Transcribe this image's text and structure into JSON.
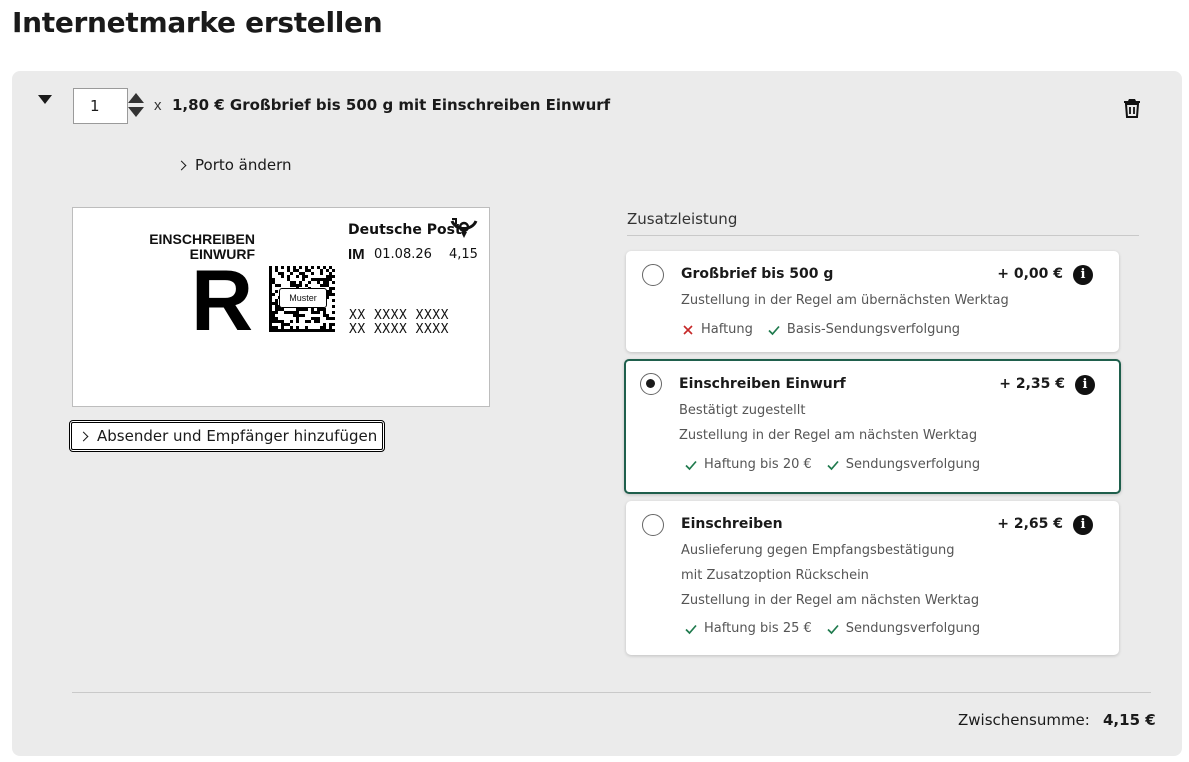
{
  "page": {
    "title": "Internetmarke erstellen"
  },
  "product": {
    "quantity": "1",
    "multiplier": "x",
    "title": "1,80 € Großbrief bis 500 g mit Einschreiben Einwurf",
    "porto_change_label": "Porto ändern"
  },
  "stamp": {
    "label_line_1": "EINSCHREIBEN",
    "label_line_2": "EINWURF",
    "big_letter": "R",
    "muster": "Muster",
    "brand": "Deutsche Post",
    "im": "IM",
    "date": "01.08.26",
    "value": "4,15",
    "code_line_1": "XX XXXX XXXX",
    "code_line_2": "XX XXXX XXXX",
    "brand_color": "#111111"
  },
  "address_button": {
    "label": "Absender und Empfänger hinzufügen"
  },
  "zusatzleistung": {
    "heading": "Zusatzleistung",
    "options": [
      {
        "title": "Großbrief bis 500 g",
        "price": "+ 0,00 €",
        "selected": false,
        "descriptions": [
          "Zustellung in der Regel am übernächsten Werktag"
        ],
        "features": [
          {
            "icon": "cross-icon",
            "label": "Haftung"
          },
          {
            "icon": "check-icon",
            "label": "Basis-Sendungsverfolgung"
          }
        ]
      },
      {
        "title": "Einschreiben Einwurf",
        "price": "+ 2,35 €",
        "selected": true,
        "descriptions": [
          "Bestätigt zugestellt",
          "Zustellung in der Regel am nächsten Werktag"
        ],
        "features": [
          {
            "icon": "check-icon",
            "label": "Haftung bis 20 €"
          },
          {
            "icon": "check-icon",
            "label": "Sendungsverfolgung"
          }
        ]
      },
      {
        "title": "Einschreiben",
        "price": "+ 2,65 €",
        "selected": false,
        "descriptions": [
          "Auslieferung gegen Empfangsbestätigung",
          "mit Zusatzoption Rückschein",
          "Zustellung in der Regel am nächsten Werktag"
        ],
        "features": [
          {
            "icon": "check-icon",
            "label": "Haftung bis 25 €"
          },
          {
            "icon": "check-icon",
            "label": "Sendungsverfolgung"
          }
        ]
      }
    ],
    "info_glyph": "i"
  },
  "summary": {
    "label": "Zwischensumme:",
    "value": "4,15 €"
  },
  "colors": {
    "selected_border": "#1f5f4c",
    "check": "#1f7a4d",
    "cross": "#c62828",
    "panel_bg": "#ebebeb"
  }
}
